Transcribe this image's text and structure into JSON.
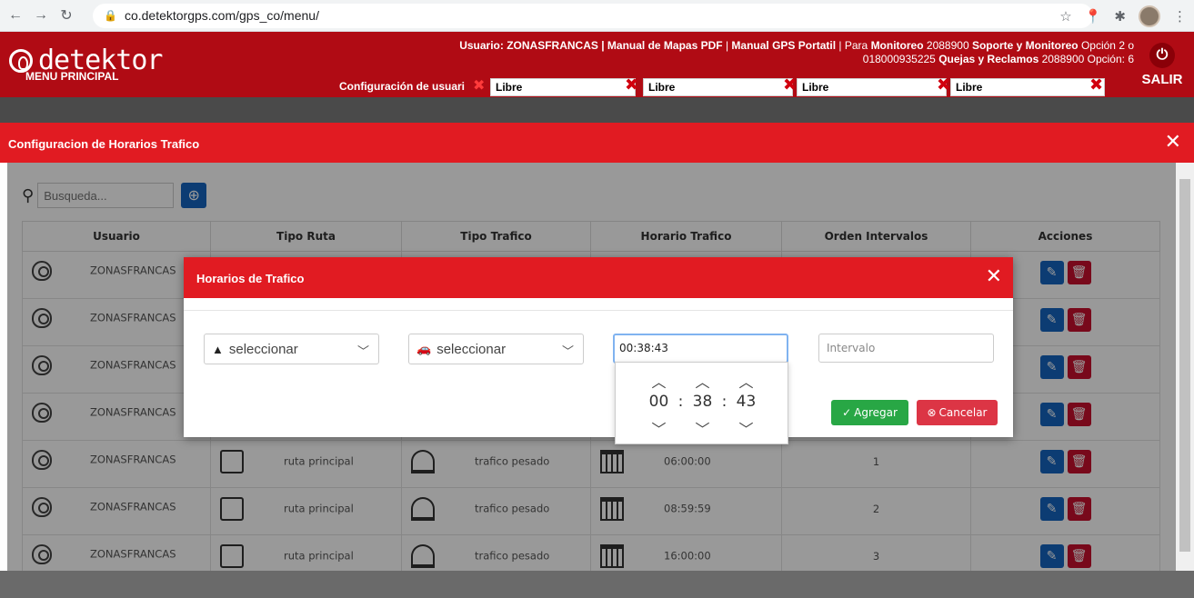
{
  "browser": {
    "url": "co.detektorgps.com/gps_co/menu/"
  },
  "header": {
    "logo": "detektor",
    "menu_label": "MENU PRINCIPAL",
    "user_info_line1_prefix": "Usuario: ZONASFRANCAS | ",
    "manual_mapas": "Manual de Mapas PDF",
    "sep1": " | ",
    "manual_gps": "Manual GPS Portatil",
    "sep2": " | Para ",
    "monitoreo": "Monitoreo",
    "phone1": " 2088900 ",
    "soporte": "Soporte y Monitoreo",
    "opcion2": " Opción 2 o",
    "phone2": "018000935225 ",
    "quejas": "Quejas y Reclamos",
    "opcion6": " 2088900 Opción: 6",
    "salir": "SALIR",
    "config_usuario": "Configuración de usuari",
    "slots": [
      "Libre",
      "Libre",
      "Libre",
      "Libre"
    ]
  },
  "page": {
    "title": "Configuracion de Horarios Trafico",
    "search_placeholder": "Busqueda...",
    "columns": [
      "Usuario",
      "Tipo Ruta",
      "Tipo Trafico",
      "Horario Trafico",
      "Orden Intervalos",
      "Acciones"
    ],
    "rows": [
      {
        "usuario": "ZONASFRANCAS",
        "ruta": "",
        "trafico": "",
        "horario": "",
        "orden": ""
      },
      {
        "usuario": "ZONASFRANCAS",
        "ruta": "",
        "trafico": "",
        "horario": "",
        "orden": ""
      },
      {
        "usuario": "ZONASFRANCAS",
        "ruta": "",
        "trafico": "",
        "horario": "",
        "orden": ""
      },
      {
        "usuario": "ZONASFRANCAS",
        "ruta": "",
        "trafico": "",
        "horario": "",
        "orden": ""
      },
      {
        "usuario": "ZONASFRANCAS",
        "ruta": "ruta principal",
        "trafico": "trafico pesado",
        "horario": "06:00:00",
        "orden": "1"
      },
      {
        "usuario": "ZONASFRANCAS",
        "ruta": "ruta principal",
        "trafico": "trafico pesado",
        "horario": "08:59:59",
        "orden": "2"
      },
      {
        "usuario": "ZONASFRANCAS",
        "ruta": "ruta principal",
        "trafico": "trafico pesado",
        "horario": "16:00:00",
        "orden": "3"
      }
    ]
  },
  "modal": {
    "title": "Horarios de Trafico",
    "select_ruta": "seleccionar",
    "select_trafico": "seleccionar",
    "time_value": "00:38:43",
    "interval_placeholder": "Intervalo",
    "agregar": "Agregar",
    "cancelar": "Cancelar",
    "picker": {
      "h": "00",
      "m": "38",
      "s": "43",
      "sep": ":"
    }
  },
  "colors": {
    "brand_red": "#b00b14",
    "title_red": "#e11b22",
    "edit_blue": "#1565c0",
    "delete_red": "#c8102e",
    "success_green": "#28a745"
  }
}
